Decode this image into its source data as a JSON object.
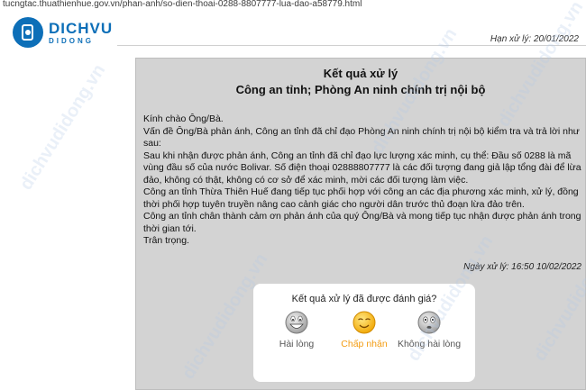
{
  "browser": {
    "url": "tucngtac.thuathienhue.gov.vn/phan-anh/so-dien-thoai-0288-8807777-lua-dao-a58779.html"
  },
  "brand": {
    "line1": "DICHVU",
    "line2": "DIDONG",
    "color": "#0d6fb8"
  },
  "header": {
    "date_fragment": "Hạn xử lý: 20/01/2022"
  },
  "result": {
    "title": "Kết quả xử lý",
    "agency": "Công an tỉnh; Phòng An ninh chính trị nội bộ",
    "paragraphs": [
      "Kính chào Ông/Bà.",
      "Vấn đề Ông/Bà phản ánh, Công an tỉnh đã chỉ đạo Phòng An ninh chính trị nội bộ kiểm tra và trả lời như sau:",
      "Sau khi nhận được phản ánh, Công an tỉnh đã chỉ đạo lực lượng xác minh, cụ thể: Đầu số 0288 là mã vùng đầu số của nước Bolivar. Số điện thoại 02888807777 là các đối tượng đang giả lập tổng đài để lừa đảo, không có thật, không có cơ sở để xác minh, mời các đối tượng làm việc.",
      "Công an tỉnh Thừa Thiên Huế đang tiếp tục phối hợp với công an các địa phương xác minh, xử lý, đồng thời phối hợp tuyên truyền nâng cao cảnh giác cho người dân trước thủ đoạn lừa đảo trên.",
      "Công an tỉnh chân thành cảm ơn phản ánh của quý Ông/Bà và mong tiếp tục nhận được phản ánh trong thời gian tới.",
      "Trân trọng."
    ],
    "processed_date": "Ngày xử lý: 16:50 10/02/2022"
  },
  "rating": {
    "question": "Kết quả xử lý đã được đánh giá?",
    "options": [
      {
        "label": "Hài lòng",
        "icon": "happy-face-icon",
        "selected": false
      },
      {
        "label": "Chấp nhận",
        "icon": "wink-face-icon",
        "selected": true
      },
      {
        "label": "Không hài lòng",
        "icon": "unhappy-face-icon",
        "selected": false
      }
    ],
    "selected_color": "#f39c12"
  },
  "watermark": {
    "text": "dichvudidong.vn"
  }
}
